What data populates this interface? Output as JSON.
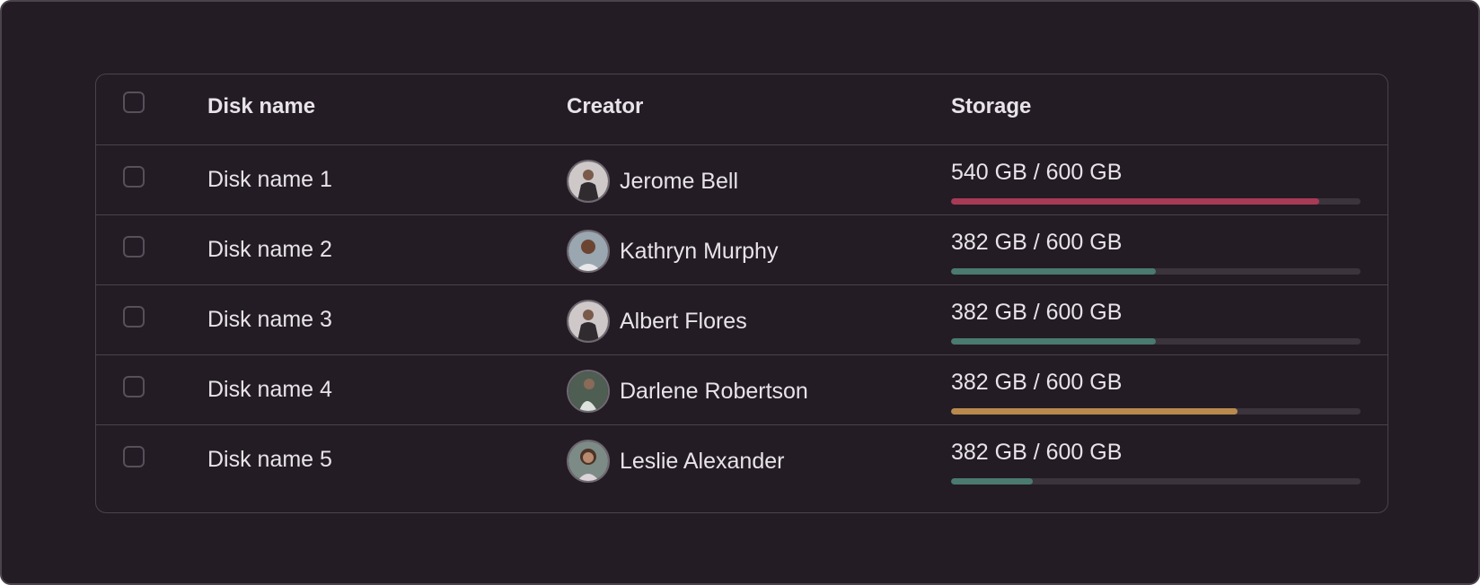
{
  "table": {
    "headers": {
      "disk_name": "Disk name",
      "creator": "Creator",
      "storage": "Storage"
    },
    "rows": [
      {
        "disk_name": "Disk name 1",
        "creator": "Jerome Bell",
        "avatar_icon": "person-avatar-icon",
        "storage_label": "540 GB / 600 GB",
        "used_fraction": 0.9,
        "bar_color": "#a73a56"
      },
      {
        "disk_name": "Disk name 2",
        "creator": "Kathryn Murphy",
        "avatar_icon": "person-avatar-icon",
        "storage_label": "382 GB / 600 GB",
        "used_fraction": 0.5,
        "bar_color": "#4a7a70"
      },
      {
        "disk_name": "Disk name 3",
        "creator": "Albert Flores",
        "avatar_icon": "person-avatar-icon",
        "storage_label": "382 GB / 600 GB",
        "used_fraction": 0.5,
        "bar_color": "#4a7a70"
      },
      {
        "disk_name": "Disk name 4",
        "creator": "Darlene Robertson",
        "avatar_icon": "person-avatar-icon",
        "storage_label": "382 GB / 600 GB",
        "used_fraction": 0.7,
        "bar_color": "#b88a4e"
      },
      {
        "disk_name": "Disk name 5",
        "creator": "Leslie Alexander",
        "avatar_icon": "person-avatar-icon",
        "storage_label": "382 GB / 600 GB",
        "used_fraction": 0.2,
        "bar_color": "#4a7a70"
      }
    ]
  },
  "colors": {
    "background": "#231c24",
    "border": "#4a434b",
    "text": "#e8e3e9",
    "bar_track": "#3b343d"
  }
}
